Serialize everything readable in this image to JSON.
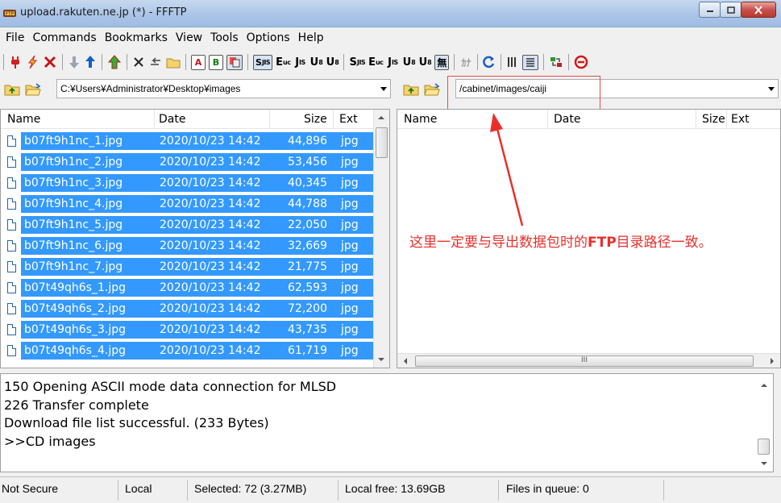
{
  "window": {
    "title": "upload.rakuten.ne.jp (*) - FFFTP"
  },
  "menu": [
    "File",
    "Commands",
    "Bookmarks",
    "View",
    "Tools",
    "Options",
    "Help"
  ],
  "toolbar": {
    "text_buttons": {
      "s_sjis": "S",
      "eu": "E",
      "jis": "J",
      "utf8n": "U",
      "utf8b": "U",
      "s2": "S",
      "e2": "E",
      "j2": "J",
      "u3": "U",
      "u4": "U",
      "none": "無",
      "kana": "ｶﾅ"
    }
  },
  "local": {
    "path": "C:¥Users¥Administrator¥Desktop¥images",
    "columns": {
      "name": "Name",
      "date": "Date",
      "size": "Size",
      "ext": "Ext"
    },
    "files": [
      {
        "name": "b07ft9h1nc_1.jpg",
        "date": "2020/10/23 14:42",
        "size": "44,896",
        "ext": "jpg"
      },
      {
        "name": "b07ft9h1nc_2.jpg",
        "date": "2020/10/23 14:42",
        "size": "53,456",
        "ext": "jpg"
      },
      {
        "name": "b07ft9h1nc_3.jpg",
        "date": "2020/10/23 14:42",
        "size": "40,345",
        "ext": "jpg"
      },
      {
        "name": "b07ft9h1nc_4.jpg",
        "date": "2020/10/23 14:42",
        "size": "44,788",
        "ext": "jpg"
      },
      {
        "name": "b07ft9h1nc_5.jpg",
        "date": "2020/10/23 14:42",
        "size": "22,050",
        "ext": "jpg"
      },
      {
        "name": "b07ft9h1nc_6.jpg",
        "date": "2020/10/23 14:42",
        "size": "32,669",
        "ext": "jpg"
      },
      {
        "name": "b07ft9h1nc_7.jpg",
        "date": "2020/10/23 14:42",
        "size": "21,775",
        "ext": "jpg"
      },
      {
        "name": "b07t49qh6s_1.jpg",
        "date": "2020/10/23 14:42",
        "size": "62,593",
        "ext": "jpg"
      },
      {
        "name": "b07t49qh6s_2.jpg",
        "date": "2020/10/23 14:42",
        "size": "72,200",
        "ext": "jpg"
      },
      {
        "name": "b07t49qh6s_3.jpg",
        "date": "2020/10/23 14:42",
        "size": "43,735",
        "ext": "jpg"
      },
      {
        "name": "b07t49qh6s_4.jpg",
        "date": "2020/10/23 14:42",
        "size": "61,719",
        "ext": "jpg"
      }
    ]
  },
  "remote": {
    "path": "/cabinet/images/caiji",
    "columns": {
      "name": "Name",
      "date": "Date",
      "size": "Size",
      "ext": "Ext"
    },
    "hscroll_grip": "III"
  },
  "annotation": {
    "before": "这里一定要与导出数据包时的",
    "bold": "FTP",
    "after": "目录路径一致。",
    "color": "#e8302b"
  },
  "log": [
    "150 Opening ASCII mode data connection for MLSD",
    "226 Transfer complete",
    "Download file list successful. (233 Bytes)",
    ">>CD images"
  ],
  "status": {
    "security": "Not Secure",
    "side": "Local",
    "selected": "Selected: 72 (3.27MB)",
    "free": "Local free: 13.69GB",
    "queue": "Files in queue: 0"
  },
  "colors": {
    "selection": "#3399ff",
    "accent_red": "#e8302b"
  }
}
